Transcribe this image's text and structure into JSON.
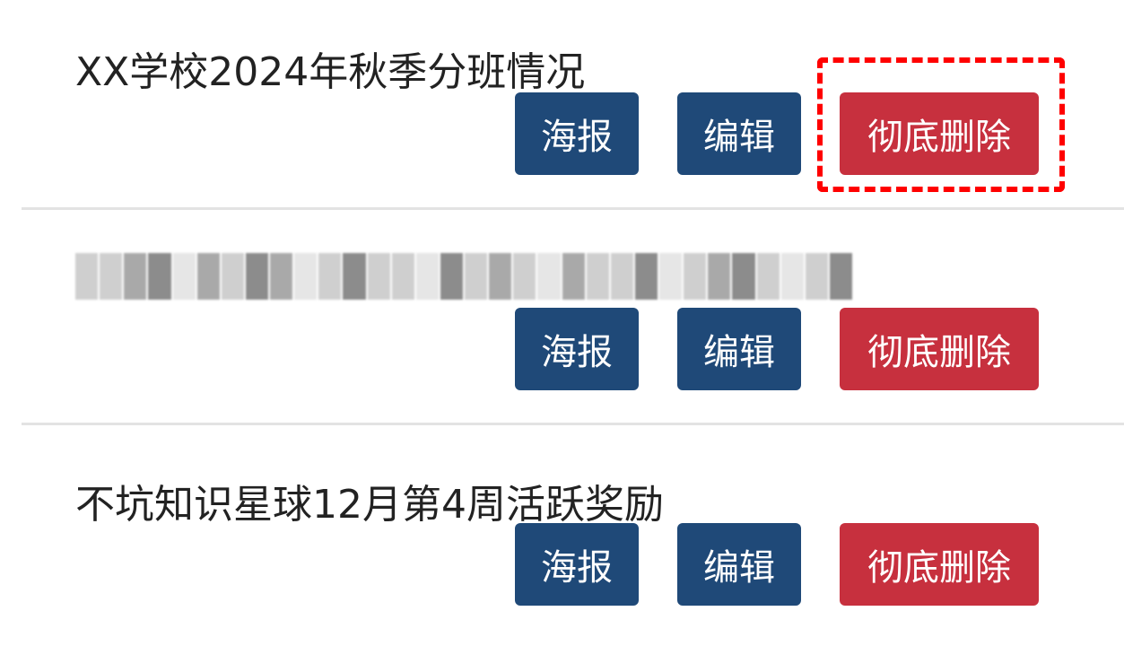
{
  "items": [
    {
      "title": "XX学校2024年秋季分班情况",
      "buttons": {
        "poster": "海报",
        "edit": "编辑",
        "delete": "彻底删除"
      }
    },
    {
      "title": "",
      "buttons": {
        "poster": "海报",
        "edit": "编辑",
        "delete": "彻底删除"
      }
    },
    {
      "title": "不坑知识星球12月第4周活跃奖励",
      "buttons": {
        "poster": "海报",
        "edit": "编辑",
        "delete": "彻底删除"
      }
    }
  ],
  "colors": {
    "primary_button": "#1f4978",
    "danger_button": "#c7303e",
    "highlight_border": "#ff0000",
    "divider": "#e3e3e3"
  }
}
